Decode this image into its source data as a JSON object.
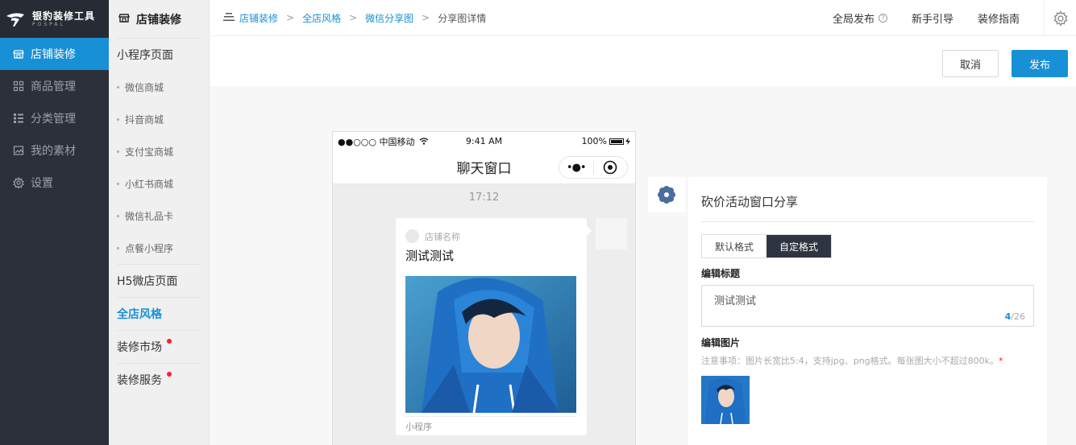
{
  "logo": {
    "title": "银豹装修工具",
    "subtitle": "POSPAL"
  },
  "sidebar": {
    "items": [
      {
        "label": "店铺装修",
        "icon": "store-icon"
      },
      {
        "label": "商品管理",
        "icon": "grid-icon"
      },
      {
        "label": "分类管理",
        "icon": "list-icon"
      },
      {
        "label": "我的素材",
        "icon": "image-icon"
      },
      {
        "label": "设置",
        "icon": "gear-icon"
      }
    ]
  },
  "subnav": {
    "header": "店铺装修",
    "mini_group": "小程序页面",
    "mini_items": [
      "微信商城",
      "抖音商城",
      "支付宝商城",
      "小红书商城",
      "微信礼品卡",
      "点餐小程序"
    ],
    "h5": "H5微店页面",
    "style": "全店风格",
    "market": "装修市场",
    "service": "装修服务"
  },
  "breadcrumb": {
    "items": [
      "店铺装修",
      "全店风格",
      "微信分享图"
    ],
    "current": "分享图详情",
    "sep": ">"
  },
  "topbar": {
    "publish_all": "全局发布",
    "guide": "新手引导",
    "manual": "装修指南",
    "help_mark": "?"
  },
  "actions": {
    "cancel": "取消",
    "publish": "发布"
  },
  "phone": {
    "carrier": "●●○○○ 中国移动",
    "time": "9:41 AM",
    "battery": "100%",
    "nav_title": "聊天窗口",
    "capsule_more": "•●•",
    "chat_time": "17:12",
    "card": {
      "shop_name": "店铺名称",
      "title": "测试测试",
      "footer": "小程序"
    }
  },
  "editor": {
    "title": "砍价活动窗口分享",
    "tabs": [
      "默认格式",
      "自定格式"
    ],
    "title_label": "编辑标题",
    "title_value": "测试测试",
    "count_current": "4",
    "count_max": "/26",
    "image_label": "编辑图片",
    "note": "注意事项：图片长宽比5:4，支持jpg、png格式。每张图大小不超过800k。",
    "required_mark": "*"
  },
  "colors": {
    "accent": "#1890d5",
    "sidebar_bg": "#2b303a",
    "tab_active": "#2f3540",
    "required": "#f5222d"
  }
}
